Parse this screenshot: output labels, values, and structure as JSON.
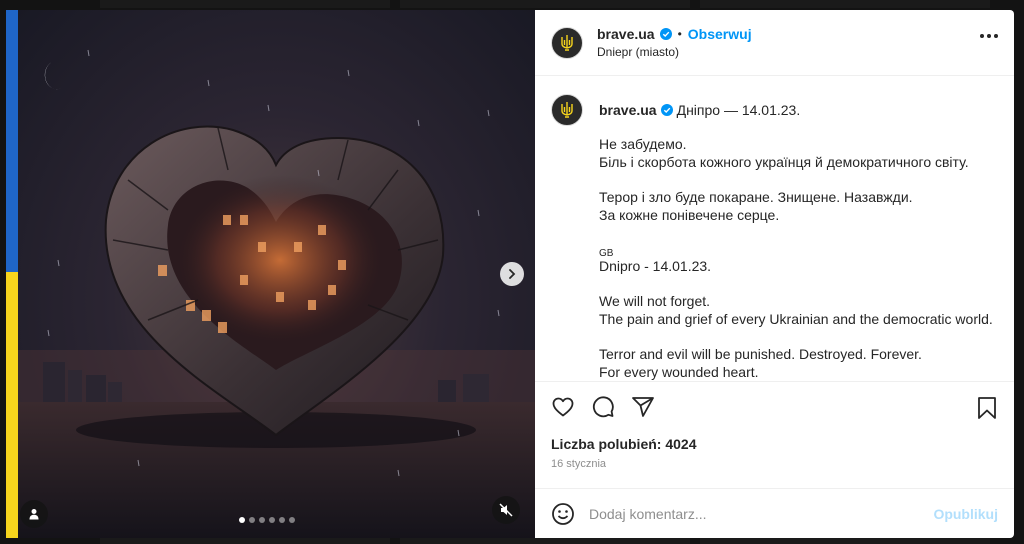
{
  "colors": {
    "accent": "#0095f6",
    "publish_disabled": "#b2dffc",
    "flag_blue": "#1f66c8",
    "flag_yellow": "#f7d51d"
  },
  "media": {
    "carousel_count": 6,
    "carousel_active": 1,
    "icons": {
      "next": "chevron-right-icon",
      "tag": "person-tag-icon",
      "mute": "speaker-muted-icon"
    }
  },
  "header": {
    "username": "brave.ua",
    "separator": "•",
    "follow_label": "Obserwuj",
    "location": "Dniepr (miasto)",
    "more_icon": "more-options-icon"
  },
  "caption": {
    "username": "brave.ua",
    "first_line": "Дніпро — 14.01.23.",
    "lines": [
      "Не забудемо.",
      "Біль і скорбота кожного українця й демократичного світу.",
      "",
      "Терор і зло буде покаране. Знищене. Назавжди.",
      "За кожне понівечене серце.",
      "",
      "GB",
      "Dnipro - 14.01.23.",
      "",
      "We will not forget.",
      "The pain and grief of every Ukrainian and the democratic world.",
      "",
      "Terror and evil will be punished. Destroyed. Forever.",
      "For every wounded heart."
    ]
  },
  "actions": {
    "icons": [
      "heart-icon",
      "comment-icon",
      "share-icon",
      "bookmark-icon"
    ]
  },
  "likes": "Liczba polubień: 4024",
  "date": "16 stycznia",
  "comment": {
    "placeholder": "Dodaj komentarz...",
    "publish_label": "Opublikuj",
    "emoji_icon": "emoji-icon"
  }
}
